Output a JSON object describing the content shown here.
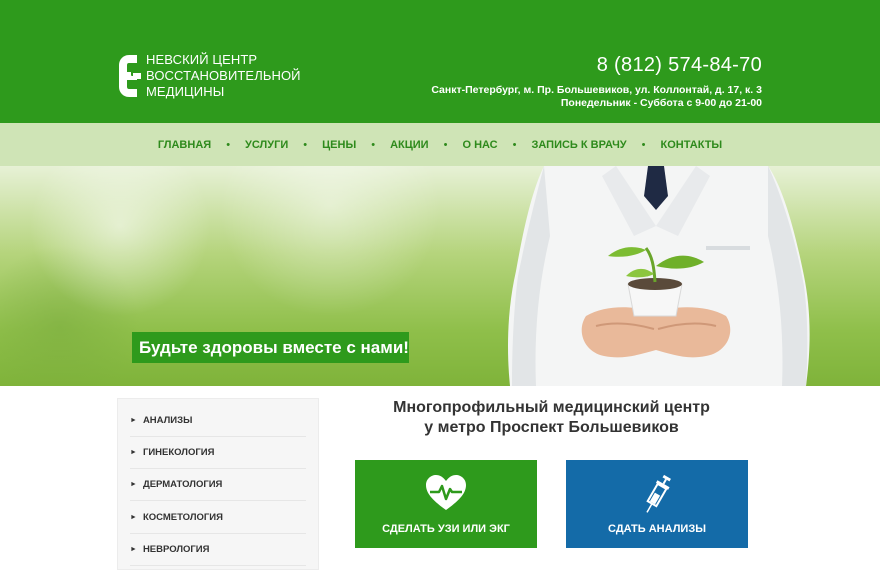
{
  "header": {
    "logo_lines": [
      "НЕВСКИЙ ЦЕНТР",
      "ВОССТАНОВИТЕЛЬНОЙ",
      "МЕДИЦИНЫ"
    ],
    "phone": "8 (812) 574-84-70",
    "address": "Санкт-Петербург, м. Пр. Большевиков, ул. Коллонтай, д. 17, к. 3",
    "hours": "Понедельник - Суббота с 9-00 до 21-00"
  },
  "nav": {
    "items": [
      "ГЛАВНАЯ",
      "УСЛУГИ",
      "ЦЕНЫ",
      "АКЦИИ",
      "О НАС",
      "ЗАПИСЬ К ВРАЧУ",
      "КОНТАКТЫ"
    ],
    "separator": "•"
  },
  "hero": {
    "slogan": "Будьте здоровы вместе с нами!"
  },
  "sidebar": {
    "items": [
      "АНАЛИЗЫ",
      "ГИНЕКОЛОГИЯ",
      "ДЕРМАТОЛОГИЯ",
      "КОСМЕТОЛОГИЯ",
      "НЕВРОЛОГИЯ"
    ],
    "arrow": "►"
  },
  "intro": {
    "line1": "Многопрофильный медицинский центр",
    "line2": "у метро Проспект Большевиков"
  },
  "tiles": [
    {
      "label": "СДЕЛАТЬ УЗИ ИЛИ ЭКГ",
      "icon": "heart-pulse-icon"
    },
    {
      "label": "СДАТЬ АНАЛИЗЫ",
      "icon": "syringe-icon"
    }
  ],
  "colors": {
    "brand_green": "#2e9a1c",
    "nav_bg": "#cfe4b6",
    "tile_blue": "#146ba8"
  }
}
